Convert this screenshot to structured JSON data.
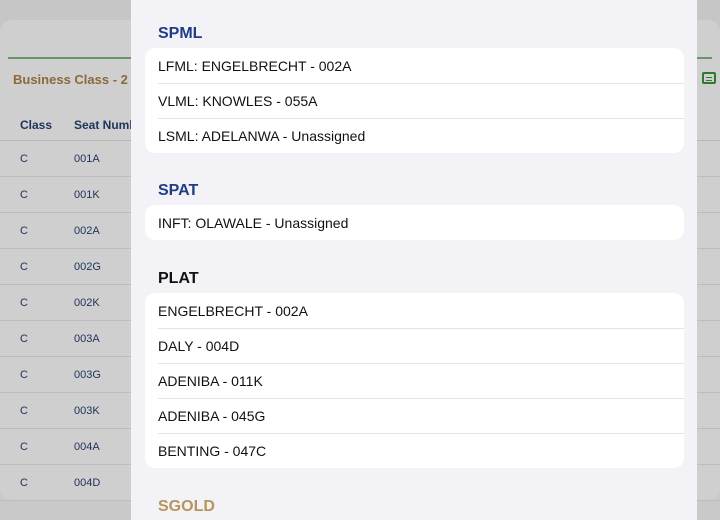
{
  "background": {
    "section_title": "Business Class - 2",
    "table": {
      "headers": [
        "Class",
        "Seat Numb"
      ],
      "rows": [
        [
          "C",
          "001A"
        ],
        [
          "C",
          "001K"
        ],
        [
          "C",
          "002A"
        ],
        [
          "C",
          "002G"
        ],
        [
          "C",
          "002K"
        ],
        [
          "C",
          "003A"
        ],
        [
          "C",
          "003G"
        ],
        [
          "C",
          "003K"
        ],
        [
          "C",
          "004A"
        ],
        [
          "C",
          "004D"
        ]
      ]
    }
  },
  "modal": {
    "sections": [
      {
        "title": "SPML",
        "title_color": "#1f3c88",
        "items": [
          "LFML: ENGELBRECHT - 002A",
          "VLML: KNOWLES - 055A",
          "LSML: ADELANWA - Unassigned"
        ]
      },
      {
        "title": "SPAT",
        "title_color": "#1f3c88",
        "items": [
          "INFT: OLAWALE -  Unassigned"
        ]
      },
      {
        "title": "PLAT",
        "title_color": "#111111",
        "items": [
          "ENGELBRECHT - 002A",
          "DALY - 004D",
          "ADENIBA - 011K",
          "ADENIBA - 045G",
          "BENTING - 047C"
        ]
      },
      {
        "title": "SGOLD",
        "title_color": "#b8945e",
        "items": []
      }
    ]
  }
}
